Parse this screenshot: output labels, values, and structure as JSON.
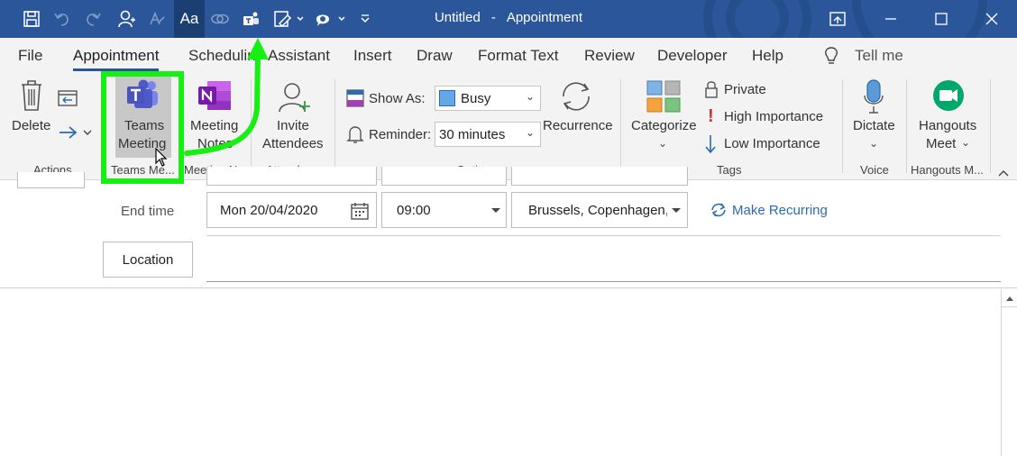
{
  "title_bar": {
    "document": "Untitled",
    "separator": "-",
    "window": "Appointment",
    "font_button": "Aa"
  },
  "tabs": [
    "File",
    "Appointment",
    "Schedulin",
    "Assistant",
    "Insert",
    "Draw",
    "Format Text",
    "Review",
    "Developer",
    "Help",
    "Tell me"
  ],
  "ribbon": {
    "actions": {
      "delete": "Delete",
      "group": "Actions"
    },
    "teams": {
      "line1": "Teams",
      "line2": "Meeting",
      "group": "Teams Me..."
    },
    "notes": {
      "line1": "Meeting",
      "line2": "Notes",
      "group": "Meeting N..."
    },
    "attendees": {
      "line1": "Invite",
      "line2": "Attendees",
      "group": "Attendees"
    },
    "options": {
      "show_as_label": "Show As:",
      "show_as_value": "Busy",
      "reminder_label": "Reminder:",
      "reminder_value": "30 minutes",
      "recurrence": "Recurrence",
      "group": "Options"
    },
    "tags": {
      "categorize": "Categorize",
      "private": "Private",
      "high": "High Importance",
      "low": "Low Importance",
      "group": "Tags"
    },
    "voice": {
      "dictate": "Dictate",
      "group": "Voice"
    },
    "hangouts": {
      "line1": "Hangouts",
      "line2": "Meet",
      "group": "Hangouts M..."
    }
  },
  "form": {
    "end_time_label": "End time",
    "end_date": "Mon 20/04/2020",
    "end_time": "09:00",
    "time_zone": "Brussels, Copenhagen, M",
    "make_recurring": "Make Recurring",
    "location_button": "Location"
  },
  "colors": {
    "title_bar": "#2b579a",
    "highlight_green": "#17ef12",
    "teams_purple": "#5059c9",
    "onenote_purple": "#7719aa",
    "link_blue": "#2b6cb0"
  }
}
